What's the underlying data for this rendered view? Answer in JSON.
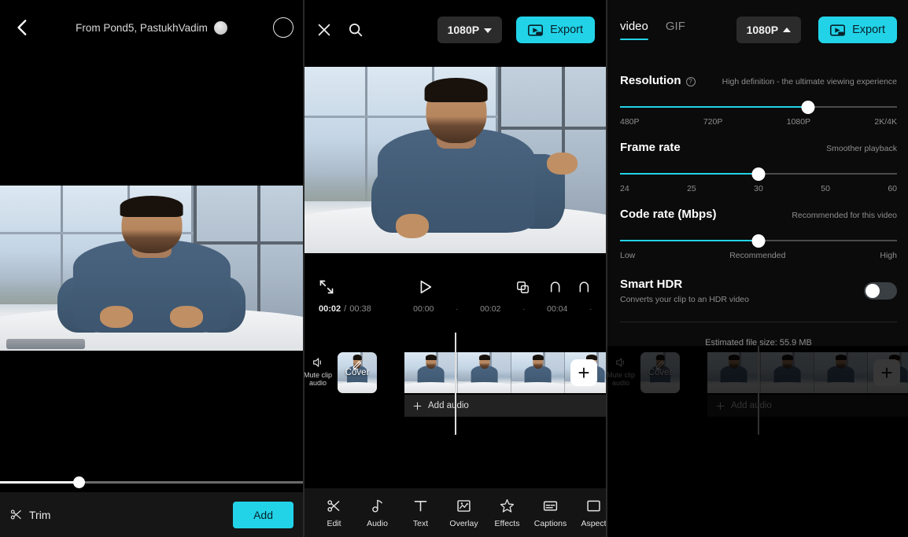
{
  "panel1": {
    "header": {
      "back_icon": "chevron-left-icon",
      "title": "From Pond5,  PastukhVadim",
      "avatar_icon": "avatar-icon",
      "select_icon": "select-circle-icon"
    },
    "scrubber": {
      "position_percent": 26
    },
    "bottom": {
      "trim_label": "Trim",
      "trim_icon": "scissors-icon",
      "add_label": "Add"
    }
  },
  "panel2": {
    "header": {
      "close_icon": "close-icon",
      "search_icon": "search-icon",
      "resolution_label": "1080P",
      "resolution_caret": "chevron-down-icon",
      "export_label": "Export",
      "export_icon": "export-video-icon"
    },
    "controls": {
      "fullscreen_icon": "fullscreen-icon",
      "play_icon": "play-icon",
      "duplicate_icon": "duplicate-icon",
      "undo_icon": "undo-icon",
      "redo_icon": "redo-icon"
    },
    "time": {
      "current": "00:02",
      "separator": "/",
      "total": "00:38"
    },
    "ruler": [
      "00:00",
      "·",
      "00:02",
      "·",
      "00:04",
      "·"
    ],
    "timeline": {
      "mute_label": "Mute clip audio",
      "mute_icon": "speaker-icon",
      "cover_label": "Cover",
      "cover_edit_icon": "pencil-icon",
      "add_clip_label": "+",
      "add_audio_label": "Add audio",
      "add_audio_icon": "plus-icon"
    },
    "toolbar": [
      {
        "label": "Edit",
        "icon": "scissors-icon"
      },
      {
        "label": "Audio",
        "icon": "music-note-icon"
      },
      {
        "label": "Text",
        "icon": "text-icon"
      },
      {
        "label": "Overlay",
        "icon": "overlay-icon"
      },
      {
        "label": "Effects",
        "icon": "sparkle-icon"
      },
      {
        "label": "Captions",
        "icon": "captions-icon"
      },
      {
        "label": "Aspect",
        "icon": "aspect-ratio-icon"
      }
    ]
  },
  "panel3": {
    "tabs": [
      {
        "label": "video",
        "active": true
      },
      {
        "label": "GIF",
        "active": false
      }
    ],
    "header": {
      "resolution_label": "1080P",
      "resolution_caret": "chevron-up-icon",
      "export_label": "Export",
      "export_icon": "export-video-icon"
    },
    "resolution": {
      "title": "Resolution",
      "help_icon": "question-mark-icon",
      "hint": "High definition - the ultimate viewing experience",
      "labels": [
        "480P",
        "720P",
        "1080P",
        "2K/4K"
      ],
      "value": "1080P",
      "fill_percent": 68
    },
    "frame_rate": {
      "title": "Frame rate",
      "hint": "Smoother playback",
      "labels": [
        "24",
        "25",
        "30",
        "50",
        "60"
      ],
      "value": "30",
      "fill_percent": 50
    },
    "code_rate": {
      "title": "Code rate (Mbps)",
      "hint": "Recommended for this video",
      "labels": [
        "Low",
        "Recommended",
        "High"
      ],
      "value": "Recommended",
      "fill_percent": 50
    },
    "smart_hdr": {
      "title": "Smart HDR",
      "subtitle": "Converts your clip to an HDR video",
      "enabled": false
    },
    "estimated_size": "Estimated file size: 55.9 MB"
  },
  "colors": {
    "accent": "#22d3e8",
    "background": "#000000",
    "panel": "#141414",
    "muted_text": "#8e8e8e"
  }
}
